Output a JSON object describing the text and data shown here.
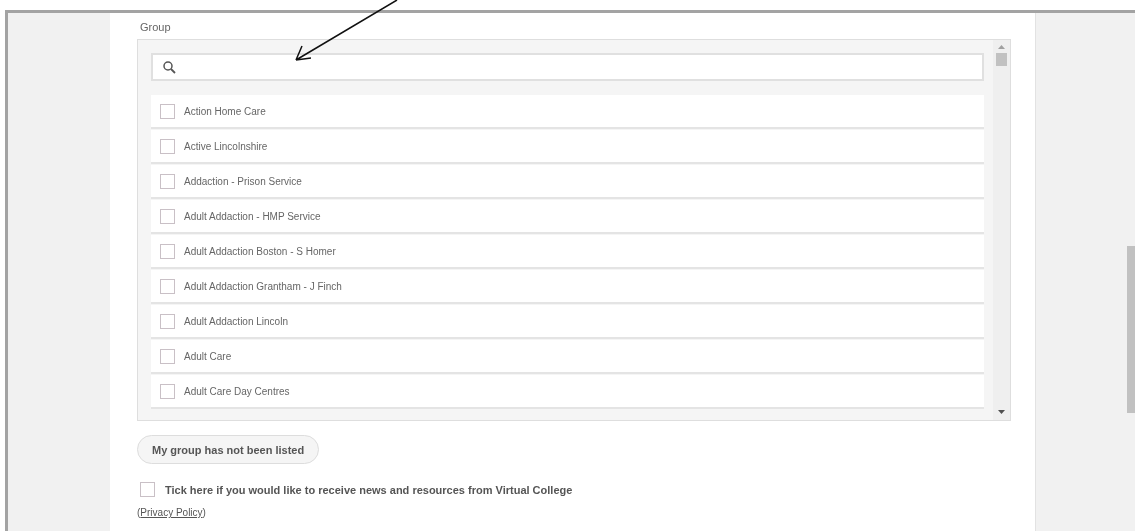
{
  "group": {
    "label": "Group",
    "options": [
      {
        "label": "Action Home Care",
        "checked": false
      },
      {
        "label": "Active Lincolnshire",
        "checked": false
      },
      {
        "label": "Addaction - Prison Service",
        "checked": false
      },
      {
        "label": "Adult Addaction - HMP Service",
        "checked": false
      },
      {
        "label": "Adult Addaction Boston - S Homer",
        "checked": false
      },
      {
        "label": "Adult Addaction Grantham - J Finch",
        "checked": false
      },
      {
        "label": "Adult Addaction Lincoln",
        "checked": false
      },
      {
        "label": "Adult Care",
        "checked": false
      },
      {
        "label": "Adult Care Day Centres",
        "checked": false
      }
    ]
  },
  "not_listed_button": "My group has not been listed",
  "newsletter": {
    "label": "Tick here if you would like to receive news and resources from Virtual College",
    "checked": false
  },
  "privacy": {
    "open": "(",
    "link": "Privacy Policy ",
    "close": ")"
  }
}
